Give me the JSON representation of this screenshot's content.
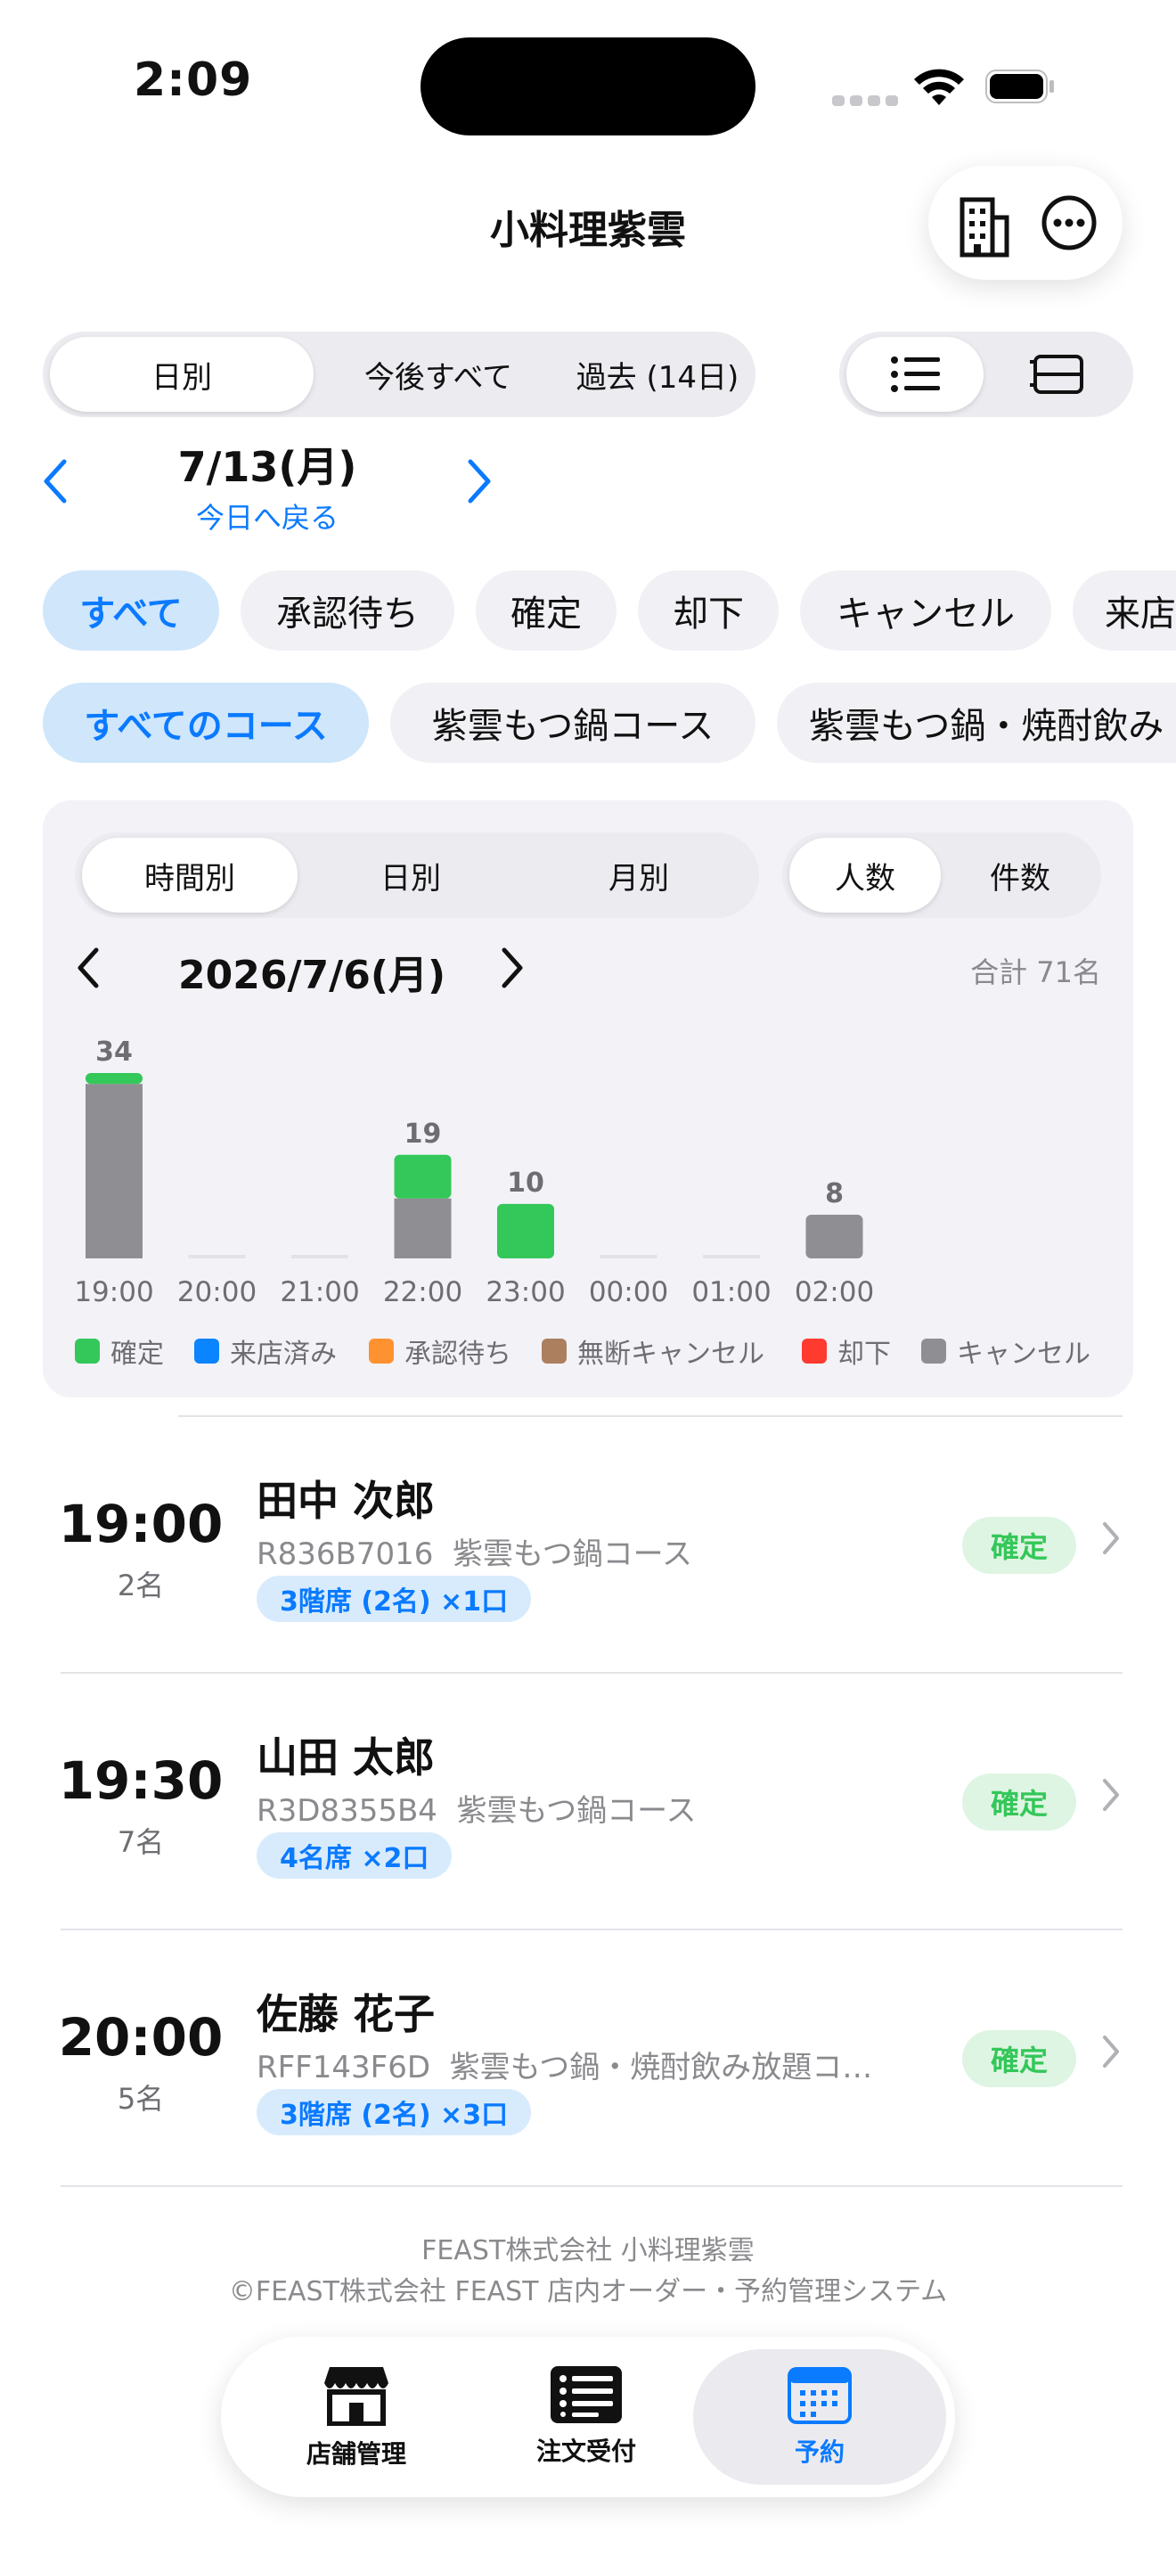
{
  "status_bar": {
    "time": "2:09"
  },
  "header": {
    "title": "小料理紫雲",
    "store_icon": "building-icon",
    "more_icon": "ellipsis-circle-icon"
  },
  "range_tabs": [
    {
      "label": "日別",
      "active": true
    },
    {
      "label": "今後すべて",
      "active": false
    },
    {
      "label": "過去 (14日)",
      "active": false
    }
  ],
  "view_toggle": {
    "list_icon": "list-icon",
    "card_icon": "rows-icon"
  },
  "date_nav": {
    "date": "7/13(月)",
    "today_link": "今日へ戻る"
  },
  "status_chips": [
    {
      "label": "すべて",
      "active": true
    },
    {
      "label": "承認待ち",
      "active": false
    },
    {
      "label": "確定",
      "active": false
    },
    {
      "label": "却下",
      "active": false
    },
    {
      "label": "キャンセル",
      "active": false
    },
    {
      "label": "来店",
      "active": false
    }
  ],
  "course_chips": [
    {
      "label": "すべてのコース",
      "active": true
    },
    {
      "label": "紫雲もつ鍋コース",
      "active": false
    },
    {
      "label": "紫雲もつ鍋・焼酎飲み",
      "active": false
    }
  ],
  "chart_panel": {
    "granularity_tabs": [
      {
        "label": "時間別",
        "active": true
      },
      {
        "label": "日別",
        "active": false
      },
      {
        "label": "月別",
        "active": false
      }
    ],
    "metric_tabs": [
      {
        "label": "人数",
        "active": true
      },
      {
        "label": "件数",
        "active": false
      }
    ],
    "date": "2026/7/6(月)",
    "total": "合計 71名"
  },
  "chart_data": {
    "type": "bar",
    "stacked": true,
    "categories": [
      "19:00",
      "20:00",
      "21:00",
      "22:00",
      "23:00",
      "00:00",
      "01:00",
      "02:00"
    ],
    "totals": [
      34,
      0,
      0,
      19,
      10,
      0,
      0,
      8
    ],
    "series": [
      {
        "name": "確定",
        "color": "#34c759",
        "values": [
          2,
          0,
          0,
          8,
          10,
          0,
          0,
          0
        ]
      },
      {
        "name": "来店済み",
        "color": "#0a84ff",
        "values": [
          0,
          0,
          0,
          0,
          0,
          0,
          0,
          0
        ]
      },
      {
        "name": "承認待ち",
        "color": "#ff9230",
        "values": [
          0,
          0,
          0,
          0,
          0,
          0,
          0,
          0
        ]
      },
      {
        "name": "無断キャンセル",
        "color": "#ac7f5e",
        "values": [
          0,
          0,
          0,
          0,
          0,
          0,
          0,
          0
        ]
      },
      {
        "name": "却下",
        "color": "#ff3b30",
        "values": [
          0,
          0,
          0,
          0,
          0,
          0,
          0,
          0
        ]
      },
      {
        "name": "キャンセル",
        "color": "#8e8e93",
        "values": [
          32,
          0,
          0,
          11,
          0,
          0,
          0,
          8
        ]
      }
    ],
    "ylim": [
      0,
      34
    ],
    "grid": false,
    "legend": "bottom"
  },
  "reservations": [
    {
      "time": "19:00",
      "party": "2名",
      "name": "田中 次郎",
      "code": "R836B7016",
      "course": "紫雲もつ鍋コース",
      "seat": "3階席 (2名) ×1口",
      "status": "確定"
    },
    {
      "time": "19:30",
      "party": "7名",
      "name": "山田 太郎",
      "code": "R3D8355B4",
      "course": "紫雲もつ鍋コース",
      "seat": "4名席 ×2口",
      "status": "確定"
    },
    {
      "time": "20:00",
      "party": "5名",
      "name": "佐藤 花子",
      "code": "RFF143F6D",
      "course": "紫雲もつ鍋・焼酎飲み放題コース",
      "seat": "3階席 (2名) ×3口",
      "status": "確定"
    }
  ],
  "footer": {
    "line1": "FEAST株式会社 小料理紫雲",
    "line2": "©FEAST株式会社 FEAST 店内オーダー・予約管理システム"
  },
  "tabbar": [
    {
      "label": "店舗管理",
      "icon": "storefront-icon",
      "active": false
    },
    {
      "label": "注文受付",
      "icon": "order-list-icon",
      "active": false
    },
    {
      "label": "予約",
      "icon": "calendar-icon",
      "active": true
    }
  ]
}
